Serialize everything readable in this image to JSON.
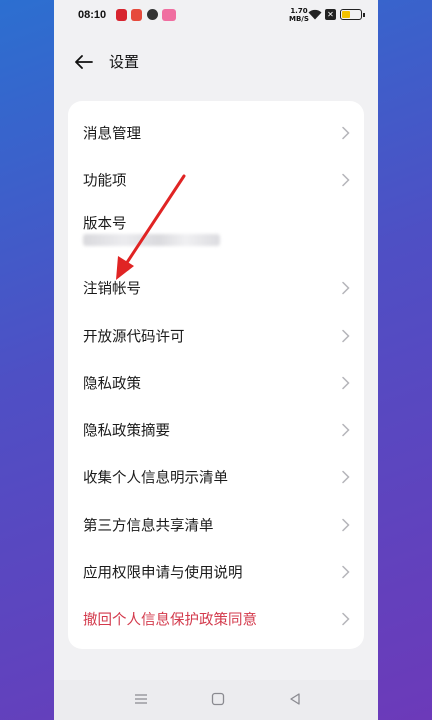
{
  "status_bar": {
    "time": "08:10",
    "net_speed_value": "1.70",
    "net_speed_unit": "MB/S"
  },
  "header": {
    "title": "设置"
  },
  "settings": {
    "items": [
      {
        "label": "消息管理",
        "chevron": true
      },
      {
        "label": "功能项",
        "chevron": true
      },
      {
        "label": "版本号",
        "chevron": false
      },
      {
        "label": "注销帐号",
        "chevron": true
      },
      {
        "label": "开放源代码许可",
        "chevron": true
      },
      {
        "label": "隐私政策",
        "chevron": true
      },
      {
        "label": "隐私政策摘要",
        "chevron": true
      },
      {
        "label": "收集个人信息明示清单",
        "chevron": true
      },
      {
        "label": "第三方信息共享清单",
        "chevron": true
      },
      {
        "label": "应用权限申请与使用说明",
        "chevron": true
      },
      {
        "label": "撤回个人信息保护政策同意",
        "chevron": true
      }
    ]
  },
  "colors": {
    "danger_text": "#d33a4c",
    "annotation_arrow": "#e02424",
    "battery_fill": "#f2c200"
  },
  "icons": {
    "back": "arrow-left-icon",
    "chevron": "chevron-right-icon",
    "nav": [
      "menu-icon",
      "home-square-icon",
      "back-triangle-icon"
    ]
  }
}
